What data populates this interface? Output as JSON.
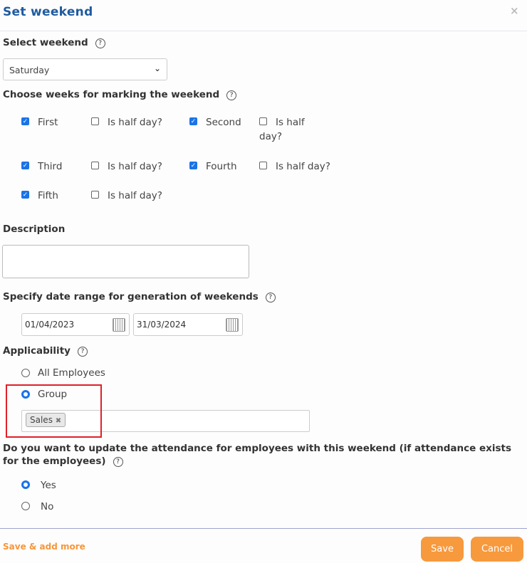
{
  "dialog": {
    "title": "Set weekend",
    "close": "×"
  },
  "select_weekend": {
    "label": "Select weekend",
    "help": "?",
    "value": "Saturday"
  },
  "weeks": {
    "label": "Choose weeks for marking the weekend",
    "help": "?",
    "items": [
      {
        "label": "First",
        "checked": true,
        "half_label": "Is half day?",
        "half": false
      },
      {
        "label": "Second",
        "checked": true,
        "half_label": "Is half",
        "half_label2": "day?",
        "half": false
      },
      {
        "label": "Third",
        "checked": true,
        "half_label": "Is half day?",
        "half": false
      },
      {
        "label": "Fourth",
        "checked": true,
        "half_label": "Is half day?",
        "half": false
      },
      {
        "label": "Fifth",
        "checked": true,
        "half_label": "Is half day?",
        "half": false
      }
    ]
  },
  "description": {
    "label": "Description",
    "value": ""
  },
  "date_range": {
    "label": "Specify date range for generation of weekends",
    "help": "?",
    "from": "01/04/2023",
    "to": "31/03/2024"
  },
  "applicability": {
    "label": "Applicability",
    "help": "?",
    "options": [
      "All Employees",
      "Group"
    ],
    "selected": "Group",
    "tags": [
      "Sales"
    ],
    "tag_remove": "✖"
  },
  "update_attendance": {
    "label1": "Do you want to update the attendance for employees with this weekend (if attendance exists",
    "label2": "for the employees)",
    "help": "?",
    "options": [
      "Yes",
      "No"
    ],
    "selected": "Yes"
  },
  "footer": {
    "save_more": "Save & add more",
    "save": "Save",
    "cancel": "Cancel"
  },
  "colors": {
    "title": "#1f5b9e",
    "accent": "#f7993d",
    "checkbox": "#1a73e8",
    "highlight": "#e0202a"
  }
}
